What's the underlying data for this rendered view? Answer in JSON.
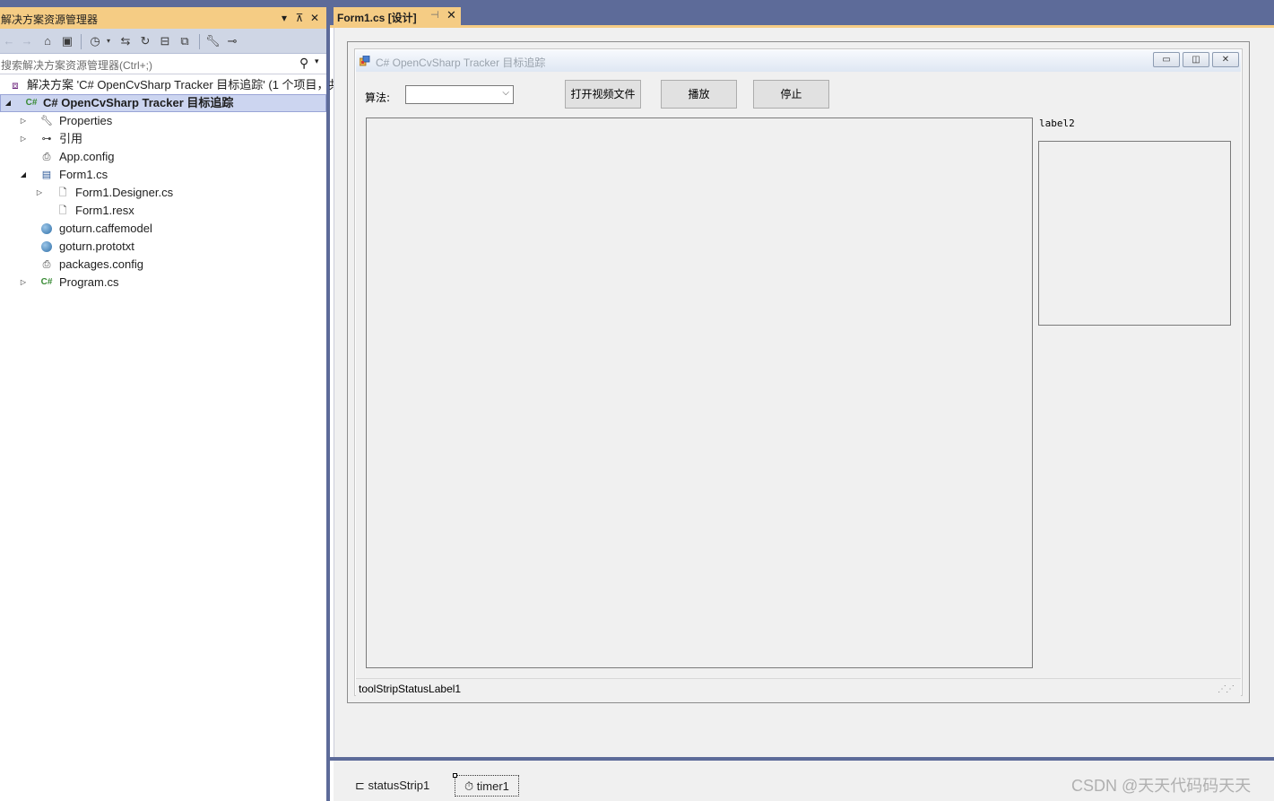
{
  "solution_explorer": {
    "title": "解决方案资源管理器",
    "title_buttons": [
      "▾",
      "⊼",
      "✕"
    ],
    "search_placeholder": "搜索解决方案资源管理器(Ctrl+;)",
    "solution_row": "解决方案 'C# OpenCvSharp Tracker 目标追踪' (1 个项目，共",
    "project_row": "C# OpenCvSharp Tracker 目标追踪",
    "items": [
      {
        "label": "Properties",
        "icon": "wrench-icon"
      },
      {
        "label": "引用",
        "icon": "references-icon"
      },
      {
        "label": "App.config",
        "icon": "config-file-icon"
      },
      {
        "label": "Form1.cs",
        "icon": "form-icon"
      },
      {
        "label": "Form1.Designer.cs",
        "icon": "file-icon"
      },
      {
        "label": "Form1.resx",
        "icon": "file-icon"
      },
      {
        "label": "goturn.caffemodel",
        "icon": "globe-icon"
      },
      {
        "label": "goturn.prototxt",
        "icon": "globe-icon"
      },
      {
        "label": "packages.config",
        "icon": "config-file-icon"
      },
      {
        "label": "Program.cs",
        "icon": "csharp-file-icon"
      }
    ]
  },
  "document_tab": {
    "label": "Form1.cs [设计]",
    "pin": "⊣",
    "close": "✕"
  },
  "form": {
    "title": "C# OpenCvSharp Tracker 目标追踪",
    "algorithm_label": "算法:",
    "algorithm_value": "",
    "buttons": {
      "open_video": "打开视频文件",
      "play": "播放",
      "stop": "停止"
    },
    "label2": "label2",
    "status_label": "toolStripStatusLabel1"
  },
  "component_tray": {
    "status_strip": "statusStrip1",
    "timer": "timer1"
  },
  "watermark": "CSDN @天天代码码天天",
  "colors": {
    "accent_tab": "#f5cc84",
    "frame": "#5d6b99",
    "selection": "#ccd5f0"
  }
}
